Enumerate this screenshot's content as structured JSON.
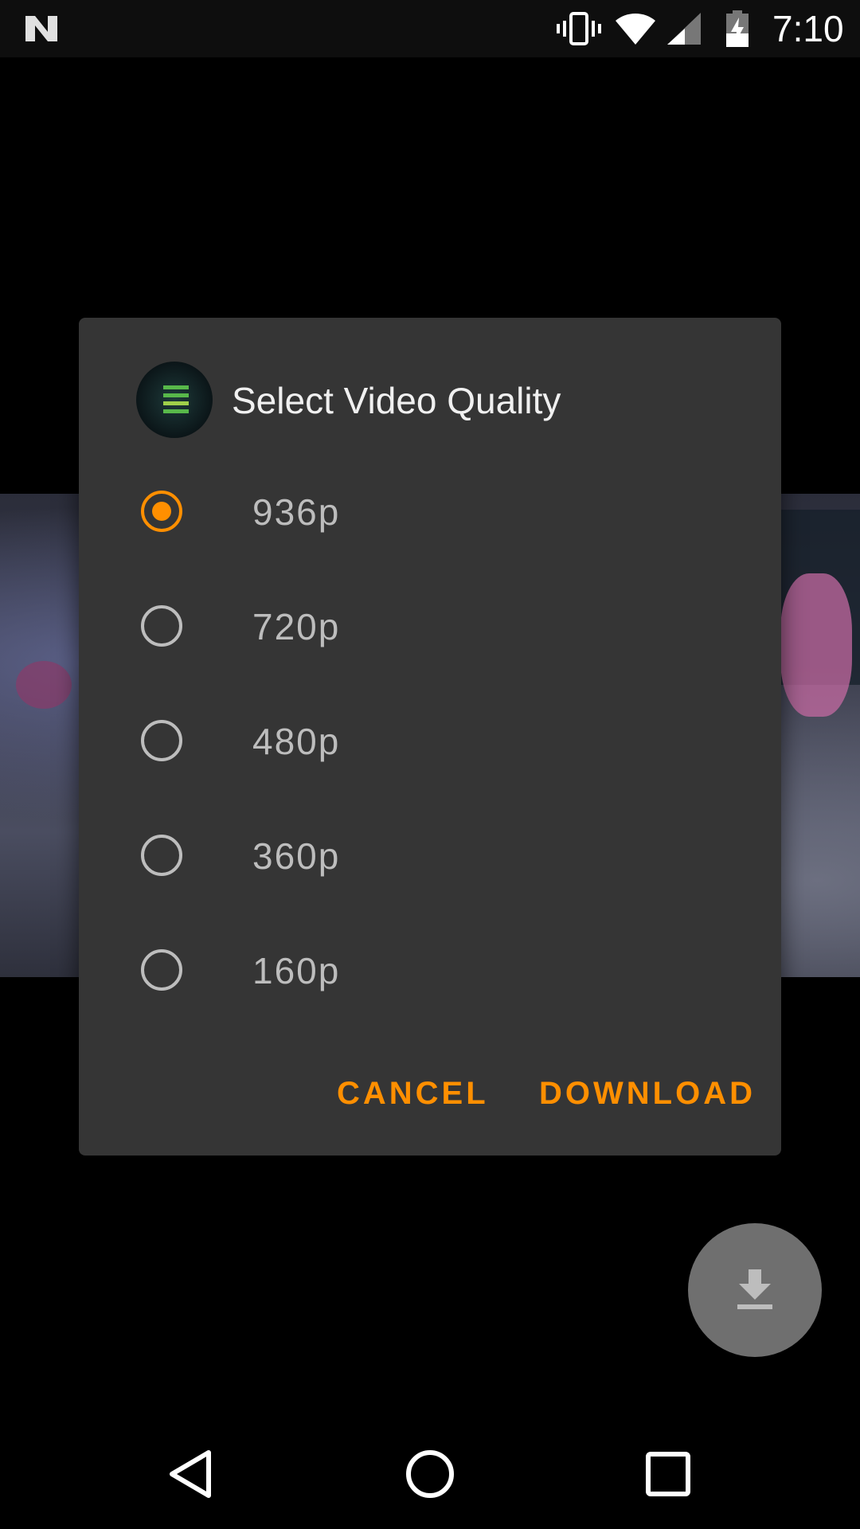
{
  "status_bar": {
    "time": "7:10",
    "icons": [
      "n-logo-icon",
      "vibrate-icon",
      "wifi-icon",
      "cell-signal-icon",
      "battery-charging-icon"
    ]
  },
  "dialog": {
    "title": "Select Video Quality",
    "options": [
      {
        "label": "936p",
        "selected": true
      },
      {
        "label": "720p",
        "selected": false
      },
      {
        "label": "480p",
        "selected": false
      },
      {
        "label": "360p",
        "selected": false
      },
      {
        "label": "160p",
        "selected": false
      }
    ],
    "cancel_label": "CANCEL",
    "download_label": "DOWNLOAD"
  },
  "fab": {
    "icon": "download-icon"
  },
  "nav_bar": {
    "icons": [
      "back-icon",
      "home-icon",
      "recents-icon"
    ]
  },
  "colors": {
    "accent": "#ff8f00",
    "dialog_bg": "#353535",
    "radio_unchecked": "#bdbdbd"
  }
}
